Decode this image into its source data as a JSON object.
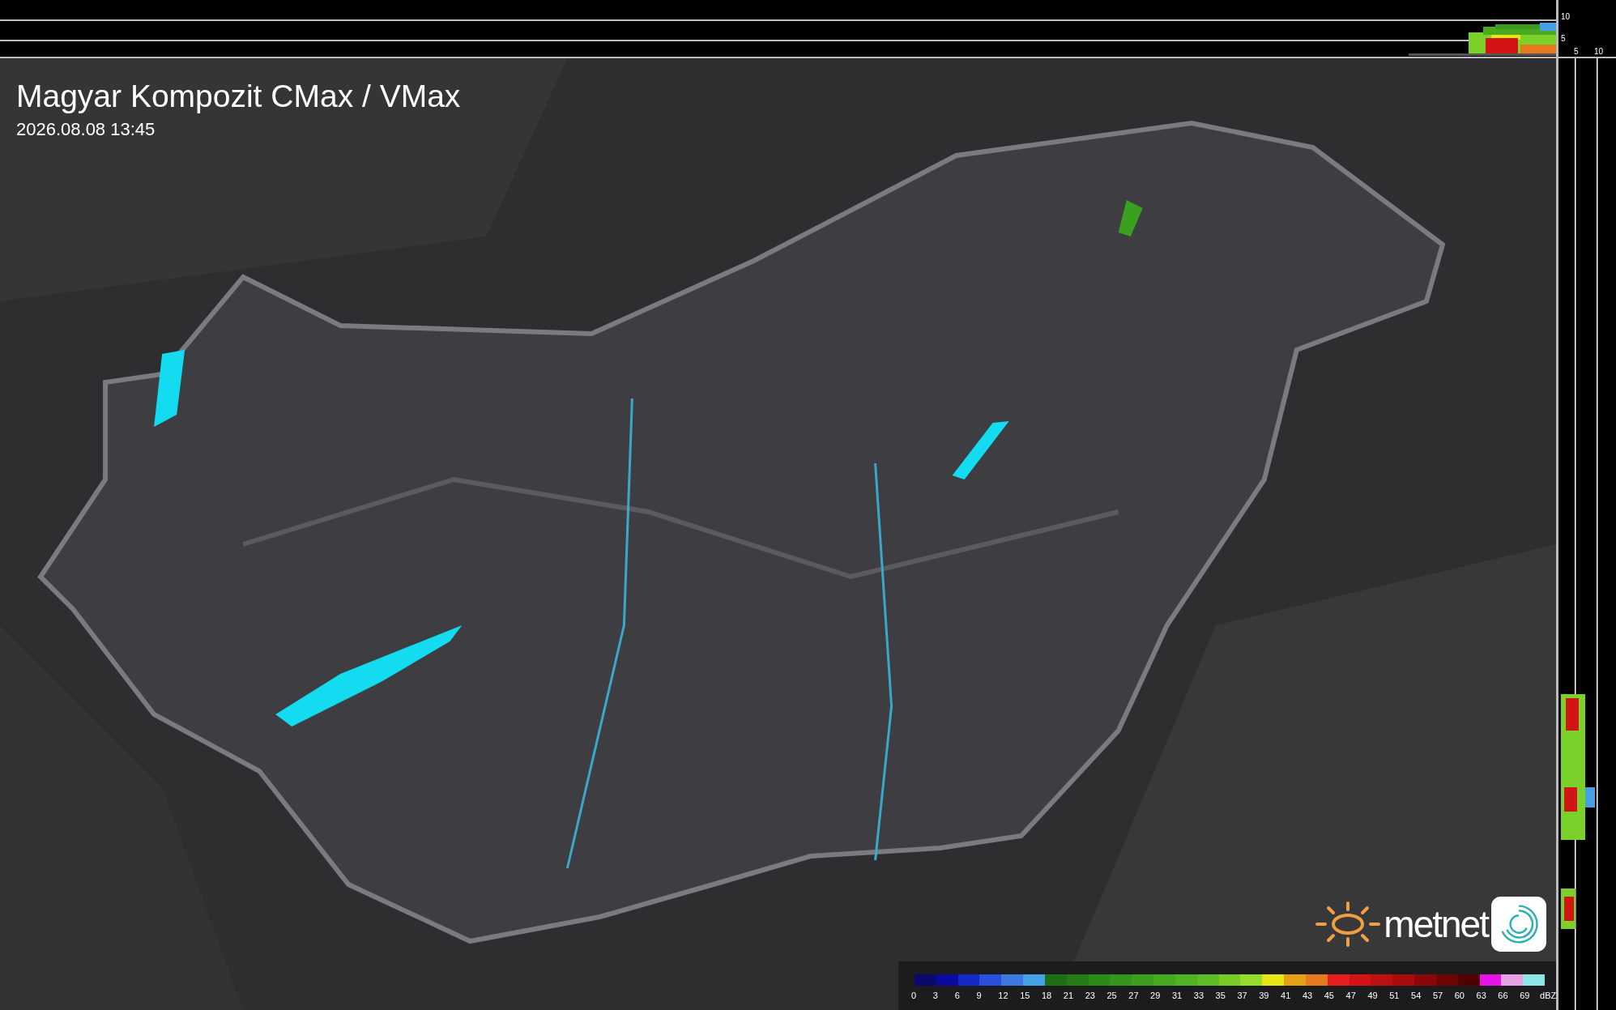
{
  "map": {
    "kind": "picture",
    "title": "Magyar Kompozit CMax / VMax",
    "timestamp": "2026.08.08 13:45"
  },
  "cross_section": {
    "height_labels": [
      "10",
      "5"
    ],
    "distance_labels": [
      "5",
      "10"
    ]
  },
  "legend": {
    "unit": "dBZ",
    "items": [
      {
        "label": "0",
        "color": "#0a0a6e"
      },
      {
        "label": "3",
        "color": "#0a0aa0"
      },
      {
        "label": "6",
        "color": "#1428c8"
      },
      {
        "label": "9",
        "color": "#2850dc"
      },
      {
        "label": "12",
        "color": "#3c78e0"
      },
      {
        "label": "15",
        "color": "#46a0e6"
      },
      {
        "label": "18",
        "color": "#1e6e14"
      },
      {
        "label": "21",
        "color": "#237d14"
      },
      {
        "label": "23",
        "color": "#2a8c18"
      },
      {
        "label": "25",
        "color": "#32961c"
      },
      {
        "label": "27",
        "color": "#3ca01e"
      },
      {
        "label": "29",
        "color": "#46aa20"
      },
      {
        "label": "31",
        "color": "#50b422"
      },
      {
        "label": "33",
        "color": "#5abe24"
      },
      {
        "label": "35",
        "color": "#78cc28"
      },
      {
        "label": "37",
        "color": "#96dc2a"
      },
      {
        "label": "39",
        "color": "#e6e614"
      },
      {
        "label": "41",
        "color": "#e6a014"
      },
      {
        "label": "43",
        "color": "#e6781e"
      },
      {
        "label": "45",
        "color": "#e61e1e"
      },
      {
        "label": "47",
        "color": "#d21414"
      },
      {
        "label": "49",
        "color": "#be1010"
      },
      {
        "label": "51",
        "color": "#aa0c0c"
      },
      {
        "label": "54",
        "color": "#8c0808"
      },
      {
        "label": "57",
        "color": "#6e0404"
      },
      {
        "label": "60",
        "color": "#500202"
      },
      {
        "label": "63",
        "color": "#e614e6"
      },
      {
        "label": "66",
        "color": "#e6a0e6"
      },
      {
        "label": "69",
        "color": "#8ce6e6"
      }
    ]
  },
  "logo": {
    "text": "metnet"
  }
}
